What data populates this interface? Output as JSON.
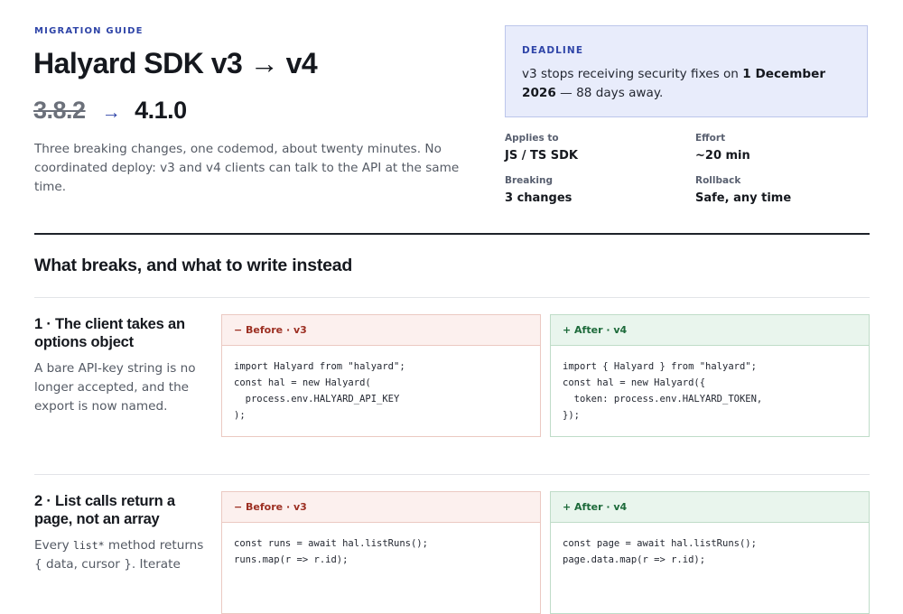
{
  "header": {
    "eyebrow": "MIGRATION GUIDE",
    "title": "Halyard SDK v3 → v4",
    "version_from": "3.8.2",
    "version_arrow": "→",
    "version_to": "4.1.0",
    "intro": "Three breaking changes, one codemod, about twenty minutes. No coordinated deploy: v3 and v4 clients can talk to the API at the same time."
  },
  "deadline": {
    "label": "DEADLINE",
    "text_prefix": "v3 stops receiving security fixes on ",
    "date": "1 December 2026",
    "text_suffix": " — 88 days away."
  },
  "meta": [
    {
      "label": "Applies to",
      "value": "JS / TS SDK"
    },
    {
      "label": "Effort",
      "value": "~20 min"
    },
    {
      "label": "Breaking",
      "value": "3 changes"
    },
    {
      "label": "Rollback",
      "value": "Safe, any time"
    }
  ],
  "section": {
    "title": "What breaks, and what to write instead"
  },
  "changes": [
    {
      "title": "1 · The client takes an options object",
      "desc": "A bare API-key string is no longer accepted, and the export is now named.",
      "desc_code": "",
      "desc_after": "",
      "before_label": "− Before · v3",
      "after_label": "+ After · v4",
      "before_code": [
        "import Halyard from \"halyard\";",
        "const hal = new Halyard(",
        "  process.env.HALYARD_API_KEY",
        ");"
      ],
      "after_code": [
        "import { Halyard } from \"halyard\";",
        "const hal = new Halyard({",
        "  token: process.env.HALYARD_TOKEN,",
        "});"
      ]
    },
    {
      "title": "2 · List calls return a page, not an array",
      "desc": "Every ",
      "desc_code": "list*",
      "desc_after": " method returns { data, cursor }. Iterate",
      "before_label": "− Before · v3",
      "after_label": "+ After · v4",
      "before_code": [
        "const runs = await hal.listRuns();",
        "runs.map(r => r.id);"
      ],
      "after_code": [
        "const page = await hal.listRuns();",
        "page.data.map(r => r.id);"
      ]
    }
  ]
}
